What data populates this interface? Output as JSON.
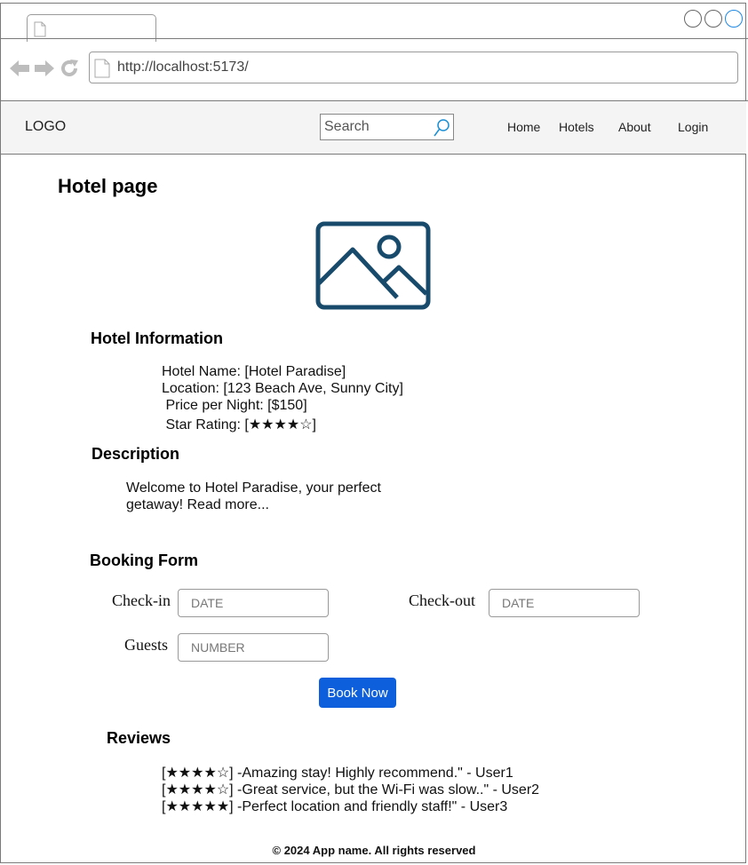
{
  "browser": {
    "url": "http://localhost:5173/",
    "window_button_colors": [
      "#666666",
      "#666666",
      "#1e88e5"
    ]
  },
  "navbar": {
    "logo": "LOGO",
    "search_placeholder": "Search",
    "links": [
      "Home",
      "Hotels",
      "About",
      "Login"
    ]
  },
  "page": {
    "title": "Hotel page",
    "image_icon": "image-placeholder-icon",
    "hotel_info": {
      "heading": "Hotel Information",
      "lines": [
        "Hotel Name: [Hotel Paradise]",
        "Location: [123 Beach Ave, Sunny City]",
        " Price per Night: [$150]",
        " Star Rating: [★★★★☆]"
      ]
    },
    "description": {
      "heading": "Description",
      "text": "Welcome to Hotel Paradise, your perfect getaway! Read more..."
    },
    "booking": {
      "heading": "Booking Form",
      "checkin_label": "Check-in",
      "checkin_placeholder": "DATE",
      "checkout_label": "Check-out",
      "checkout_placeholder": "DATE",
      "guests_label": "Guests",
      "guests_placeholder": "NUMBER",
      "button": "Book Now"
    },
    "reviews": {
      "heading": "Reviews",
      "items": [
        "[★★★★☆] -Amazing stay! Highly recommend.\" - User1",
        "[★★★★☆] -Great service, but the Wi-Fi was slow..\" - User2",
        "[★★★★★] -Perfect location and friendly staff!\" - User3"
      ]
    }
  },
  "footer": "© 2024 App name. All rights reserved",
  "colors": {
    "accent": "#0d5fdc",
    "image_icon": "#174a6b",
    "navbar_bg": "#f4f4f4"
  }
}
